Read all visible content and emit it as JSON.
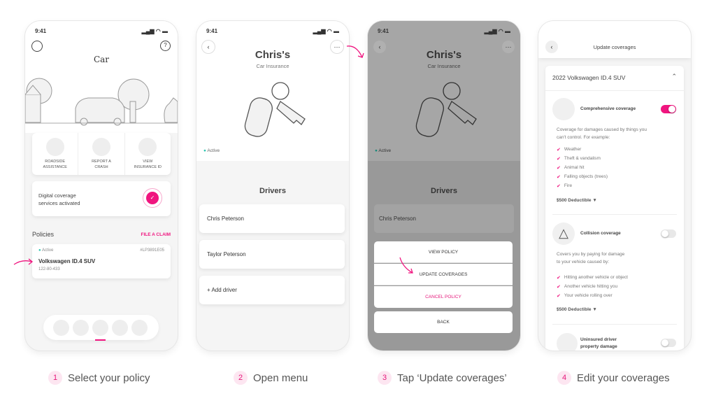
{
  "colors": {
    "accent": "#f0157f",
    "active": "#2cc5b0"
  },
  "status_time": "9:41",
  "screen1": {
    "title": "Car",
    "actions": [
      {
        "label1": "ROADSIDE",
        "label2": "ASSISTANCE",
        "icon": "roadside-icon"
      },
      {
        "label1": "REPORT A",
        "label2": "CRASH",
        "icon": "crash-icon"
      },
      {
        "label1": "VIEW",
        "label2": "INSURANCE ID",
        "icon": "id-card-icon"
      }
    ],
    "digital_line1": "Digital coverage",
    "digital_line2": "services activated",
    "policies_label": "Policies",
    "file_claim": "FILE A CLAIM",
    "policy": {
      "status": "Active",
      "number": "#LP3891E05",
      "name": "Volkswagen ID.4 SUV",
      "id": "122-80-433"
    },
    "nav_icons": [
      "building-icon",
      "home-icon",
      "car-icon",
      "paw-icon",
      "photo-icon"
    ]
  },
  "screen2": {
    "name": "Chris's",
    "subtitle": "Car Insurance",
    "status": "Active",
    "drivers_title": "Drivers",
    "drivers": [
      "Chris Peterson",
      "Taylor Peterson"
    ],
    "add_driver": "+ Add driver"
  },
  "screen3": {
    "name": "Chris's",
    "subtitle": "Car Insurance",
    "status": "Active",
    "drivers_title": "Drivers",
    "driver": "Chris Peterson",
    "menu": [
      "VIEW POLICY",
      "UPDATE COVERAGES",
      "CANCEL POLICY"
    ],
    "back": "BACK"
  },
  "screen4": {
    "title": "Update coverages",
    "vehicle": "2022 Volkswagen ID.4 SUV",
    "coverages": [
      {
        "name": "Comprehensive coverage",
        "enabled": true,
        "desc1": "Coverage for damages caused by things you",
        "desc2": "can't control. For example:",
        "items": [
          "Weather",
          "Theft & vandalism",
          "Animal hit",
          "Falling objects (trees)",
          "Fire"
        ],
        "deductible": "$500 Deductible"
      },
      {
        "name": "Collision coverage",
        "enabled": false,
        "desc1": "Covers you by paying for damage",
        "desc2": "to your vehicle caused by:",
        "items": [
          "Hitting another vehicle or object",
          "Another vehicle hitting you",
          "Your vehicle rolling over"
        ],
        "deductible": "$500 Deductible"
      },
      {
        "name1": "Uninsured driver",
        "name2": "property damage",
        "enabled": false
      }
    ]
  },
  "steps": [
    {
      "n": "1",
      "label": "Select your policy"
    },
    {
      "n": "2",
      "label": "Open menu"
    },
    {
      "n": "3",
      "label": "Tap ‘Update coverages’"
    },
    {
      "n": "4",
      "label": "Edit your coverages"
    }
  ]
}
